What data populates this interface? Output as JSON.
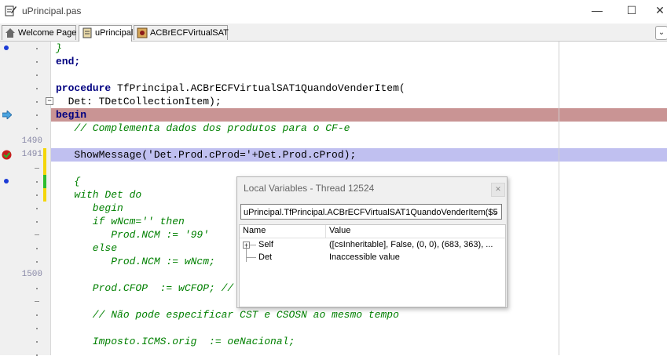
{
  "window": {
    "title": "uPrincipal.pas",
    "controls": {
      "minimize": "—",
      "maximize": "☐",
      "close": "✕"
    }
  },
  "tabs": [
    {
      "label": "Welcome Page",
      "icon": "home-icon"
    },
    {
      "label": "uPrincipal",
      "icon": "unit-file-icon",
      "active": true
    },
    {
      "label": "ACBrECFVirtualSAT",
      "icon": "component-icon"
    }
  ],
  "tab_dropdown": "⌄",
  "code": [
    {
      "parts": [
        {
          "t": "}",
          "c": "cm",
          "i": 0
        }
      ]
    },
    {
      "parts": [
        {
          "t": "end;",
          "c": "kw",
          "i": 0
        }
      ]
    },
    {
      "parts": []
    },
    {
      "parts": [
        {
          "t": "procedure",
          "c": "kw",
          "i": 0
        },
        {
          "t": " TfPrincipal.ACBrECFVirtualSAT1QuandoVenderItem(",
          "c": "",
          "i": 1
        }
      ]
    },
    {
      "parts": [
        {
          "t": "  Det: TDetCollectionItem);",
          "c": "",
          "i": 0
        }
      ]
    },
    {
      "parts": [
        {
          "t": "begin",
          "c": "kw",
          "i": 0
        }
      ]
    },
    {
      "parts": [
        {
          "t": "   // Complementa dados dos produtos para o CF-e",
          "c": "cm",
          "i": 0
        }
      ]
    },
    {
      "parts": []
    },
    {
      "parts": [
        {
          "t": "   ShowMessage('Det.Prod.cProd='+Det.Prod.cProd);",
          "c": "",
          "i": 0
        }
      ]
    },
    {
      "parts": []
    },
    {
      "parts": [
        {
          "t": "   {",
          "c": "cm",
          "i": 0
        }
      ]
    },
    {
      "parts": [
        {
          "t": "   with Det do",
          "c": "cm",
          "i": 0
        }
      ]
    },
    {
      "parts": [
        {
          "t": "      begin",
          "c": "cm",
          "i": 0
        }
      ]
    },
    {
      "parts": [
        {
          "t": "      if wNcm='' then",
          "c": "cm",
          "i": 0
        }
      ]
    },
    {
      "parts": [
        {
          "t": "         Prod.NCM := '99'",
          "c": "cm",
          "i": 0
        }
      ]
    },
    {
      "parts": [
        {
          "t": "      else",
          "c": "cm",
          "i": 0
        }
      ]
    },
    {
      "parts": [
        {
          "t": "         Prod.NCM := wNcm;",
          "c": "cm",
          "i": 0
        }
      ]
    },
    {
      "parts": []
    },
    {
      "parts": [
        {
          "t": "      Prod.CFOP  := wCFOP; //",
          "c": "cm",
          "i": 0
        }
      ]
    },
    {
      "parts": []
    },
    {
      "parts": [
        {
          "t": "      // Não pode especificar CST e CSOSN ao mesmo tempo",
          "c": "cm",
          "i": 0
        }
      ]
    },
    {
      "parts": []
    },
    {
      "parts": [
        {
          "t": "      Imposto.ICMS.orig  := oeNacional;",
          "c": "cm",
          "i": 0
        }
      ]
    }
  ],
  "line_numbers": [
    {
      "row": 7,
      "label": "1490"
    },
    {
      "row": 8,
      "label": "1491"
    },
    {
      "row": 17,
      "label": "1500"
    }
  ],
  "local_variables": {
    "title": "Local Variables - Thread 12524",
    "close": "✕",
    "scope": "uPrincipal.TfPrincipal.ACBrECFVirtualSAT1QuandoVenderItem($5",
    "columns": [
      "Name",
      "Value"
    ],
    "rows": [
      {
        "name": "Self",
        "value": "([csInheritable], False, (0, 0), (683, 363), ...",
        "expandable": true
      },
      {
        "name": "Det",
        "value": "Inaccessible value",
        "expandable": false
      }
    ]
  },
  "colors": {
    "exec_line": "#c99494",
    "breakpoint_line": "#c0c0f0",
    "keyword": "#000080",
    "comment": "#008000"
  }
}
